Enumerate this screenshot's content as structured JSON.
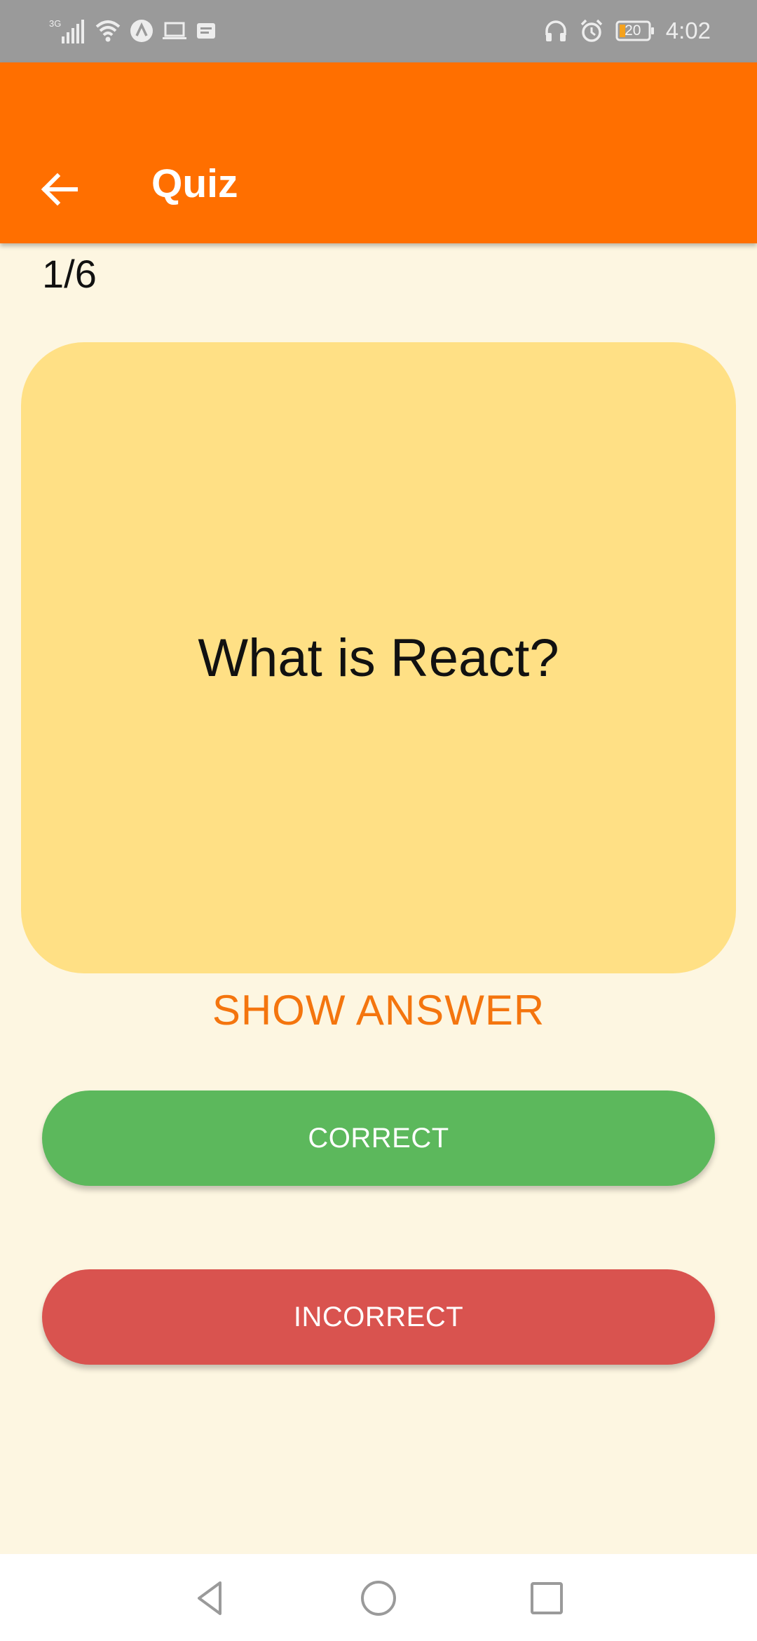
{
  "status_bar": {
    "network_label": "3G",
    "battery_level": "20",
    "time": "4:02"
  },
  "app_bar": {
    "title": "Quiz",
    "back_icon": "arrow-left-icon"
  },
  "quiz": {
    "progress": "1/6",
    "question": "What is React?",
    "show_answer_label": "SHOW ANSWER",
    "correct_label": "CORRECT",
    "incorrect_label": "INCORRECT"
  },
  "colors": {
    "app_bar": "#FF6F00",
    "background": "#FDF6E1",
    "card": "#FFE085",
    "show_answer": "#F4750E",
    "correct": "#5CB85C",
    "incorrect": "#D9534F"
  },
  "nav_bar": {
    "back_icon": "triangle-back-icon",
    "home_icon": "circle-home-icon",
    "recent_icon": "square-recents-icon"
  }
}
